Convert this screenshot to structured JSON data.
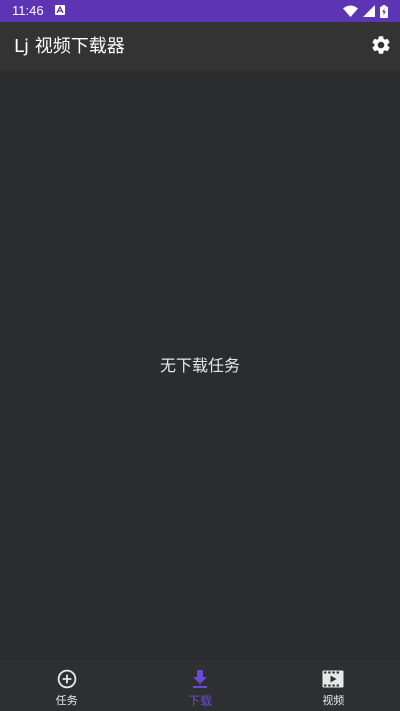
{
  "status_bar": {
    "time": "11:46",
    "bg_color": "#5c34b4",
    "icons": [
      "notification-a-icon",
      "wifi-icon",
      "signal-icon",
      "battery-icon"
    ]
  },
  "app_bar": {
    "title": "Lj 视频下载器",
    "actions": [
      "gear-icon"
    ]
  },
  "content": {
    "empty_message": "无下载任务"
  },
  "bottom_nav": {
    "active_color": "#6a4bd6",
    "items": [
      {
        "label": "任务",
        "icon": "add-circle-icon",
        "active": false
      },
      {
        "label": "下载",
        "icon": "download-icon",
        "active": true
      },
      {
        "label": "视频",
        "icon": "video-film-icon",
        "active": false
      }
    ]
  }
}
